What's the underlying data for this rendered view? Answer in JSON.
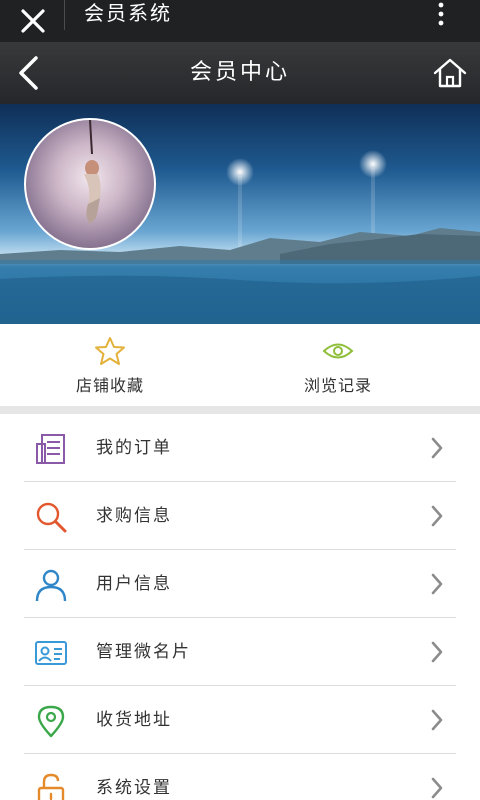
{
  "topbar": {
    "title": "会员系统",
    "icons": [
      "close-icon",
      "more-vertical-icon"
    ]
  },
  "header": {
    "title": "会员中心",
    "icons": [
      "back-icon",
      "home-icon"
    ]
  },
  "quick_actions": [
    {
      "label": "店铺收藏",
      "icon": "star-icon",
      "color": "#e3b13a"
    },
    {
      "label": "浏览记录",
      "icon": "eye-icon",
      "color": "#8fbf3a"
    }
  ],
  "menu": [
    {
      "label": "我的订单",
      "icon": "order-list-icon",
      "color": "#8a5aa8"
    },
    {
      "label": "求购信息",
      "icon": "search-icon",
      "color": "#e2572e"
    },
    {
      "label": "用户信息",
      "icon": "user-icon",
      "color": "#2f86c8"
    },
    {
      "label": "管理微名片",
      "icon": "id-card-icon",
      "color": "#3a9ad8"
    },
    {
      "label": "收货地址",
      "icon": "location-pin-icon",
      "color": "#3aa84a"
    },
    {
      "label": "系统设置",
      "icon": "lock-settings-icon",
      "color": "#e58a2a"
    }
  ]
}
